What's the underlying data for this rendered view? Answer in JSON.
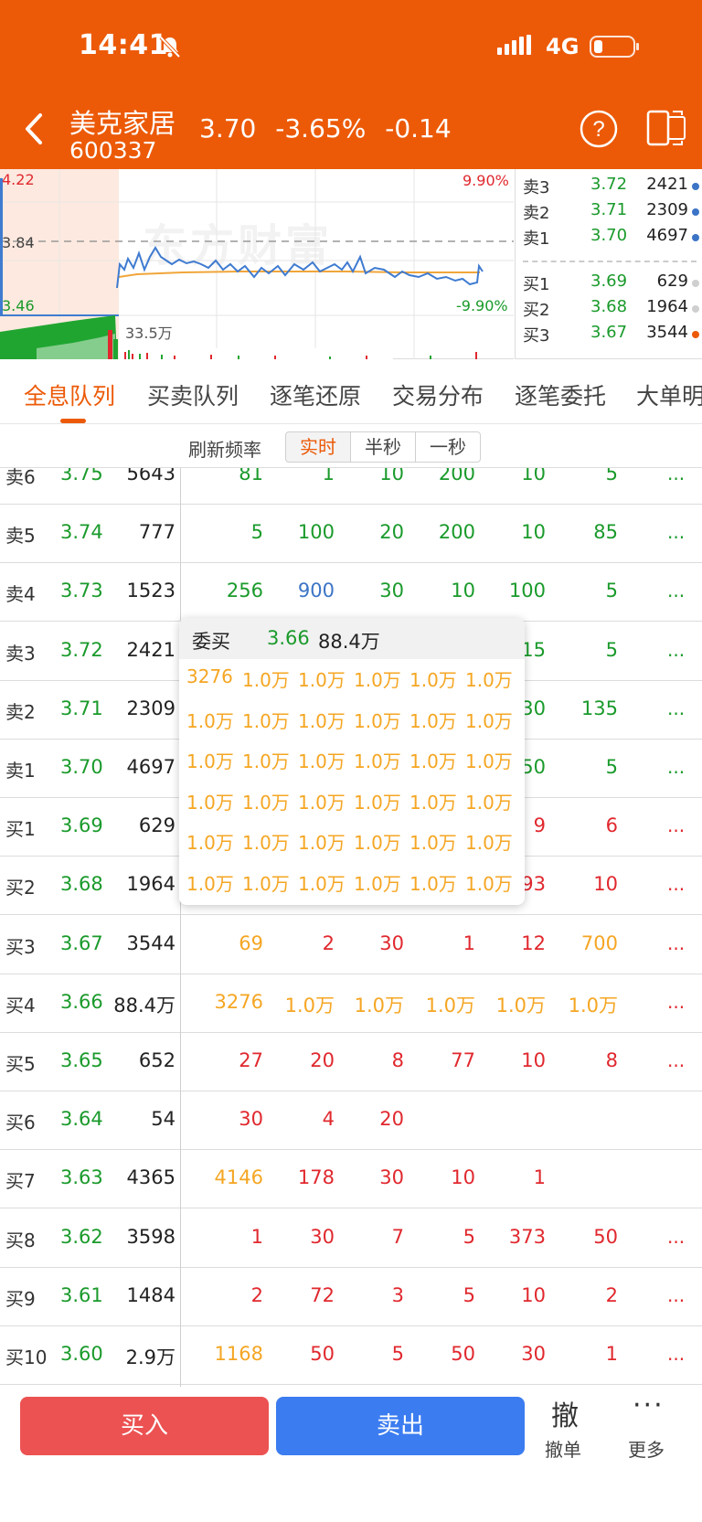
{
  "status": {
    "time": "14:41",
    "network": "4G"
  },
  "header": {
    "name": "美克家居",
    "code": "600337",
    "price": "3.70",
    "change_pct": "-3.65%",
    "change": "-0.14"
  },
  "chart": {
    "high_label": "4.22",
    "mid_label": "3.84",
    "low_label": "3.46",
    "up_pct": "9.90%",
    "down_pct": "-9.90%",
    "volume_label": "33.5万",
    "watermark": "东方财富",
    "colors": {
      "price_line": "#3f7bd0",
      "avg_line": "#f0a63a",
      "volume_down": "#21a531",
      "volume_up": "#e0282e"
    }
  },
  "mini_book": [
    {
      "label": "卖3",
      "price": "3.72",
      "vol": "2421",
      "dot": "#3c74c6"
    },
    {
      "label": "卖2",
      "price": "3.71",
      "vol": "2309",
      "dot": "#3c74c6"
    },
    {
      "label": "卖1",
      "price": "3.70",
      "vol": "4697",
      "dot": "#3c74c6"
    },
    {
      "label": "买1",
      "price": "3.69",
      "vol": "629",
      "dot": "#cfcfcf"
    },
    {
      "label": "买2",
      "price": "3.68",
      "vol": "1964",
      "dot": "#cfcfcf"
    },
    {
      "label": "买3",
      "price": "3.67",
      "vol": "3544",
      "dot": "#ec5a08"
    }
  ],
  "tabs": [
    "全息队列",
    "买卖队列",
    "逐笔还原",
    "交易分布",
    "逐笔委托",
    "大单明"
  ],
  "refresh": {
    "label": "刷新频率",
    "options": [
      "实时",
      "半秒",
      "一秒"
    ]
  },
  "queue": [
    {
      "label": "卖6",
      "price": "3.75",
      "vol": "5643",
      "orders": [
        [
          "81",
          "green"
        ],
        [
          "1",
          "green"
        ],
        [
          "10",
          "green"
        ],
        [
          "200",
          "green"
        ],
        [
          "10",
          "green"
        ],
        [
          "5",
          "green"
        ]
      ],
      "more": "..."
    },
    {
      "label": "卖5",
      "price": "3.74",
      "vol": "777",
      "orders": [
        [
          "5",
          "green"
        ],
        [
          "100",
          "green"
        ],
        [
          "20",
          "green"
        ],
        [
          "200",
          "green"
        ],
        [
          "10",
          "green"
        ],
        [
          "85",
          "green"
        ]
      ],
      "more": "..."
    },
    {
      "label": "卖4",
      "price": "3.73",
      "vol": "1523",
      "orders": [
        [
          "256",
          "green"
        ],
        [
          "900",
          "blue"
        ],
        [
          "30",
          "green"
        ],
        [
          "10",
          "green"
        ],
        [
          "100",
          "green"
        ],
        [
          "5",
          "green"
        ]
      ],
      "more": "..."
    },
    {
      "label": "卖3",
      "price": "3.72",
      "vol": "2421",
      "orders": [
        [
          "",
          "green"
        ],
        [
          "",
          "green"
        ],
        [
          "",
          "green"
        ],
        [
          "",
          "green"
        ],
        [
          "15",
          "green"
        ],
        [
          "5",
          "green"
        ]
      ],
      "more": "..."
    },
    {
      "label": "卖2",
      "price": "3.71",
      "vol": "2309",
      "orders": [
        [
          "",
          "green"
        ],
        [
          "",
          "green"
        ],
        [
          "",
          "green"
        ],
        [
          "",
          "green"
        ],
        [
          "30",
          "green"
        ],
        [
          "135",
          "green"
        ]
      ],
      "more": "..."
    },
    {
      "label": "卖1",
      "price": "3.70",
      "vol": "4697",
      "orders": [
        [
          "",
          "green"
        ],
        [
          "",
          "green"
        ],
        [
          "",
          "green"
        ],
        [
          "",
          "green"
        ],
        [
          "50",
          "green"
        ],
        [
          "5",
          "green"
        ]
      ],
      "more": "..."
    },
    {
      "label": "买1",
      "price": "3.69",
      "vol": "629",
      "orders": [
        [
          "",
          "red"
        ],
        [
          "",
          "red"
        ],
        [
          "",
          "red"
        ],
        [
          "",
          "red"
        ],
        [
          "9",
          "red"
        ],
        [
          "6",
          "red"
        ]
      ],
      "more": "..."
    },
    {
      "label": "买2",
      "price": "3.68",
      "vol": "1964",
      "orders": [
        [
          "",
          "red"
        ],
        [
          "",
          "red"
        ],
        [
          "",
          "red"
        ],
        [
          "",
          "red"
        ],
        [
          "93",
          "red"
        ],
        [
          "10",
          "red"
        ]
      ],
      "more": "..."
    },
    {
      "label": "买3",
      "price": "3.67",
      "vol": "3544",
      "orders": [
        [
          "69",
          "orange"
        ],
        [
          "2",
          "red"
        ],
        [
          "30",
          "red"
        ],
        [
          "1",
          "red"
        ],
        [
          "12",
          "red"
        ],
        [
          "700",
          "orange"
        ]
      ],
      "more": "..."
    },
    {
      "label": "买4",
      "price": "3.66",
      "vol": "88.4万",
      "orders": [
        [
          "3276",
          "orange"
        ],
        [
          "1.0万",
          "orange"
        ],
        [
          "1.0万",
          "orange"
        ],
        [
          "1.0万",
          "orange"
        ],
        [
          "1.0万",
          "orange"
        ],
        [
          "1.0万",
          "orange"
        ]
      ],
      "more": "..."
    },
    {
      "label": "买5",
      "price": "3.65",
      "vol": "652",
      "orders": [
        [
          "27",
          "red"
        ],
        [
          "20",
          "red"
        ],
        [
          "8",
          "red"
        ],
        [
          "77",
          "red"
        ],
        [
          "10",
          "red"
        ],
        [
          "8",
          "red"
        ]
      ],
      "more": "..."
    },
    {
      "label": "买6",
      "price": "3.64",
      "vol": "54",
      "orders": [
        [
          "30",
          "red"
        ],
        [
          "4",
          "red"
        ],
        [
          "20",
          "red"
        ],
        [
          "",
          "red"
        ],
        [
          "",
          "red"
        ],
        [
          "",
          "red"
        ]
      ],
      "more": ""
    },
    {
      "label": "买7",
      "price": "3.63",
      "vol": "4365",
      "orders": [
        [
          "4146",
          "orange"
        ],
        [
          "178",
          "red"
        ],
        [
          "30",
          "red"
        ],
        [
          "10",
          "red"
        ],
        [
          "1",
          "red"
        ],
        [
          "",
          "red"
        ]
      ],
      "more": ""
    },
    {
      "label": "买8",
      "price": "3.62",
      "vol": "3598",
      "orders": [
        [
          "1",
          "red"
        ],
        [
          "30",
          "red"
        ],
        [
          "7",
          "red"
        ],
        [
          "5",
          "red"
        ],
        [
          "373",
          "red"
        ],
        [
          "50",
          "red"
        ]
      ],
      "more": "..."
    },
    {
      "label": "买9",
      "price": "3.61",
      "vol": "1484",
      "orders": [
        [
          "2",
          "red"
        ],
        [
          "72",
          "red"
        ],
        [
          "3",
          "red"
        ],
        [
          "5",
          "red"
        ],
        [
          "10",
          "red"
        ],
        [
          "2",
          "red"
        ]
      ],
      "more": "..."
    },
    {
      "label": "买10",
      "price": "3.60",
      "vol": "2.9万",
      "orders": [
        [
          "1168",
          "orange"
        ],
        [
          "50",
          "red"
        ],
        [
          "5",
          "red"
        ],
        [
          "50",
          "red"
        ],
        [
          "30",
          "red"
        ],
        [
          "1",
          "red"
        ]
      ],
      "more": "..."
    }
  ],
  "popup": {
    "title": "委买",
    "price": "3.66",
    "vol": "88.4万",
    "rows": [
      [
        "3276",
        "1.0万",
        "1.0万",
        "1.0万",
        "1.0万",
        "1.0万"
      ],
      [
        "1.0万",
        "1.0万",
        "1.0万",
        "1.0万",
        "1.0万",
        "1.0万"
      ],
      [
        "1.0万",
        "1.0万",
        "1.0万",
        "1.0万",
        "1.0万",
        "1.0万"
      ],
      [
        "1.0万",
        "1.0万",
        "1.0万",
        "1.0万",
        "1.0万",
        "1.0万"
      ],
      [
        "1.0万",
        "1.0万",
        "1.0万",
        "1.0万",
        "1.0万",
        "1.0万"
      ],
      [
        "1.0万",
        "1.0万",
        "1.0万",
        "1.0万",
        "1.0万",
        "1.0万"
      ]
    ]
  },
  "bottom": {
    "buy": "买入",
    "sell": "卖出",
    "cancel_glyph": "撤",
    "cancel": "撤单",
    "more_glyph": "···",
    "more": "更多"
  }
}
